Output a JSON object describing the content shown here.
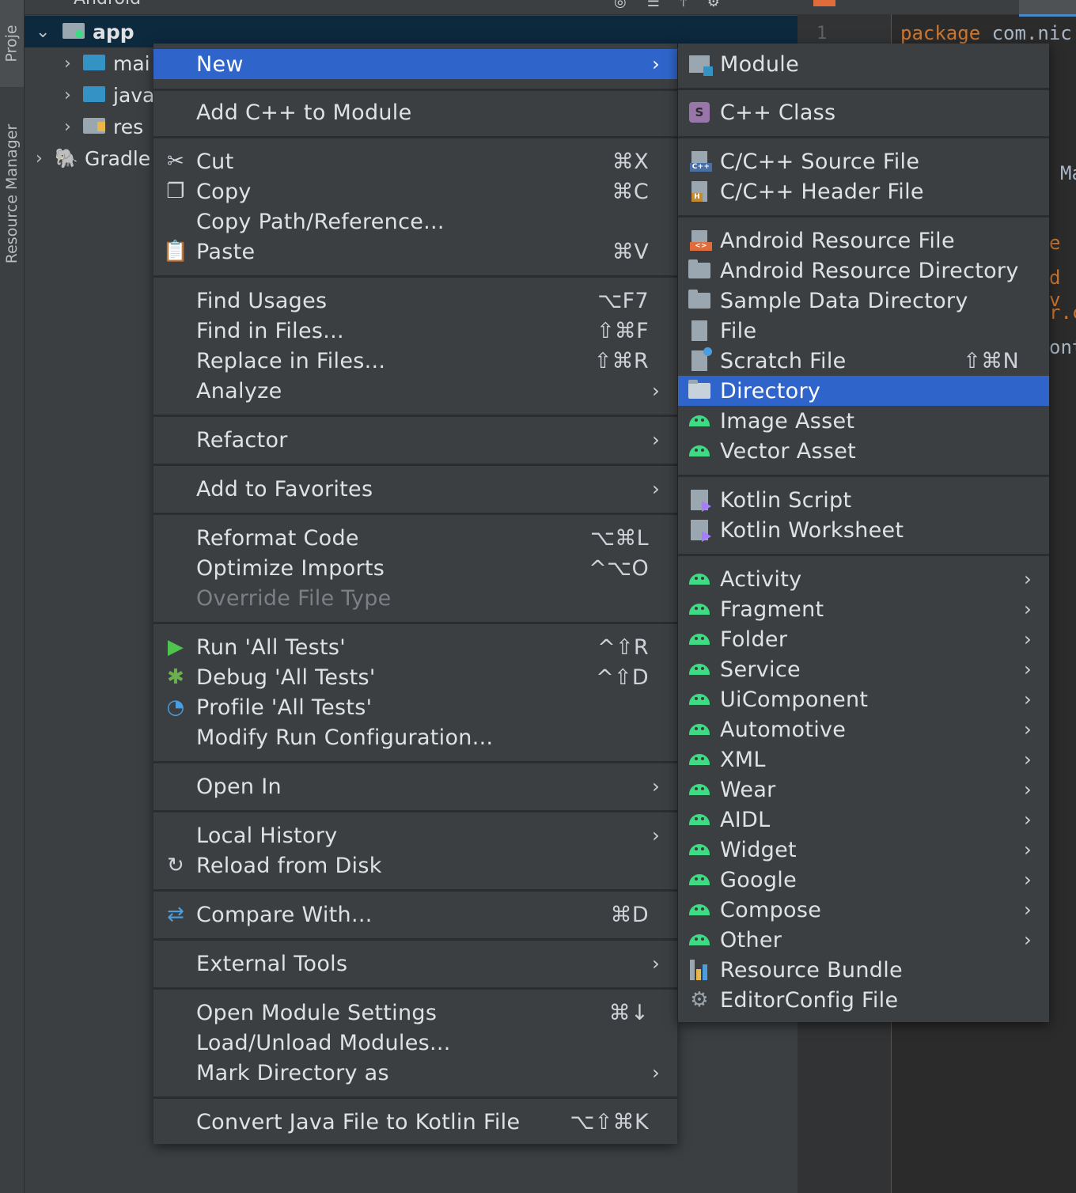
{
  "sidebar": {
    "project_tab": "Proje",
    "resource_manager_tab": "Resource Manager"
  },
  "project_panel": {
    "header_title": "Android",
    "tree": [
      {
        "label": "app",
        "kind": "module"
      },
      {
        "label": "mai",
        "kind": "folder"
      },
      {
        "label": "java",
        "kind": "folder"
      },
      {
        "label": "res",
        "kind": "res-folder"
      },
      {
        "label": "Gradle",
        "kind": "gradle"
      }
    ]
  },
  "editor": {
    "line_number": "1",
    "keyword": "package",
    "identifier": "com.nic",
    "fragments": [
      "Ma",
      "e",
      "d v",
      "r.c",
      "ont"
    ]
  },
  "context_menu": {
    "items": [
      {
        "label": "New",
        "submenu": true,
        "selected": true
      },
      {
        "label": "Add C++ to Module"
      },
      {
        "label": "Cut",
        "shortcut": "⌘X",
        "icon": "scissors-icon"
      },
      {
        "label": "Copy",
        "shortcut": "⌘C",
        "icon": "copy-icon"
      },
      {
        "label": "Copy Path/Reference..."
      },
      {
        "label": "Paste",
        "shortcut": "⌘V",
        "icon": "paste-icon"
      },
      {
        "label": "Find Usages",
        "shortcut": "⌥F7"
      },
      {
        "label": "Find in Files...",
        "shortcut": "⇧⌘F"
      },
      {
        "label": "Replace in Files...",
        "shortcut": "⇧⌘R"
      },
      {
        "label": "Analyze",
        "submenu": true
      },
      {
        "label": "Refactor",
        "submenu": true
      },
      {
        "label": "Add to Favorites",
        "submenu": true
      },
      {
        "label": "Reformat Code",
        "shortcut": "⌥⌘L"
      },
      {
        "label": "Optimize Imports",
        "shortcut": "^⌥O"
      },
      {
        "label": "Override File Type",
        "disabled": true
      },
      {
        "label": "Run 'All Tests'",
        "shortcut": "^⇧R",
        "icon": "run-icon"
      },
      {
        "label": "Debug 'All Tests'",
        "shortcut": "^⇧D",
        "icon": "debug-icon"
      },
      {
        "label": "Profile 'All Tests'",
        "icon": "profile-icon"
      },
      {
        "label": "Modify Run Configuration..."
      },
      {
        "label": "Open In",
        "submenu": true
      },
      {
        "label": "Local History",
        "submenu": true
      },
      {
        "label": "Reload from Disk",
        "icon": "reload-icon"
      },
      {
        "label": "Compare With...",
        "shortcut": "⌘D",
        "icon": "compare-icon"
      },
      {
        "label": "External Tools",
        "submenu": true
      },
      {
        "label": "Open Module Settings",
        "shortcut": "⌘↓"
      },
      {
        "label": "Load/Unload Modules..."
      },
      {
        "label": "Mark Directory as",
        "submenu": true
      },
      {
        "label": "Convert Java File to Kotlin File",
        "shortcut": "⌥⇧⌘K"
      }
    ]
  },
  "new_submenu": {
    "items": [
      {
        "label": "Module",
        "icon": "module-icon"
      },
      {
        "label": "C++ Class",
        "icon": "cpp-class-icon",
        "badge": "S"
      },
      {
        "label": "C/C++ Source File",
        "icon": "cpp-source-file-icon",
        "badge": "C++"
      },
      {
        "label": "C/C++ Header File",
        "icon": "cpp-header-file-icon",
        "badge": "H"
      },
      {
        "label": "Android Resource File",
        "icon": "android-resource-file-icon",
        "badge": "<>"
      },
      {
        "label": "Android Resource Directory",
        "icon": "folder-icon"
      },
      {
        "label": "Sample Data Directory",
        "icon": "folder-icon"
      },
      {
        "label": "File",
        "icon": "file-icon"
      },
      {
        "label": "Scratch File",
        "icon": "scratch-file-icon",
        "shortcut": "⇧⌘N"
      },
      {
        "label": "Directory",
        "icon": "folder-icon",
        "selected": true
      },
      {
        "label": "Image Asset",
        "icon": "android-icon"
      },
      {
        "label": "Vector Asset",
        "icon": "android-icon"
      },
      {
        "label": "Kotlin Script",
        "icon": "kotlin-file-icon"
      },
      {
        "label": "Kotlin Worksheet",
        "icon": "kotlin-file-icon"
      },
      {
        "label": "Activity",
        "icon": "android-icon",
        "submenu": true
      },
      {
        "label": "Fragment",
        "icon": "android-icon",
        "submenu": true
      },
      {
        "label": "Folder",
        "icon": "android-icon",
        "submenu": true
      },
      {
        "label": "Service",
        "icon": "android-icon",
        "submenu": true
      },
      {
        "label": "UiComponent",
        "icon": "android-icon",
        "submenu": true
      },
      {
        "label": "Automotive",
        "icon": "android-icon",
        "submenu": true
      },
      {
        "label": "XML",
        "icon": "android-icon",
        "submenu": true
      },
      {
        "label": "Wear",
        "icon": "android-icon",
        "submenu": true
      },
      {
        "label": "AIDL",
        "icon": "android-icon",
        "submenu": true
      },
      {
        "label": "Widget",
        "icon": "android-icon",
        "submenu": true
      },
      {
        "label": "Google",
        "icon": "android-icon",
        "submenu": true
      },
      {
        "label": "Compose",
        "icon": "android-icon",
        "submenu": true
      },
      {
        "label": "Other",
        "icon": "android-icon",
        "submenu": true
      },
      {
        "label": "Resource Bundle",
        "icon": "resource-bundle-icon"
      },
      {
        "label": "EditorConfig File",
        "icon": "gear-icon"
      }
    ]
  },
  "colors": {
    "selection": "#2f65ca",
    "menu_bg": "#3c3f41",
    "android_green": "#3ddc84",
    "kotlin_purple": "#a97bff",
    "keyword_orange": "#cc7832"
  },
  "glyphs": {
    "submenu_arrow": "›",
    "tree_expanded": "⌄",
    "tree_collapsed": "›"
  }
}
